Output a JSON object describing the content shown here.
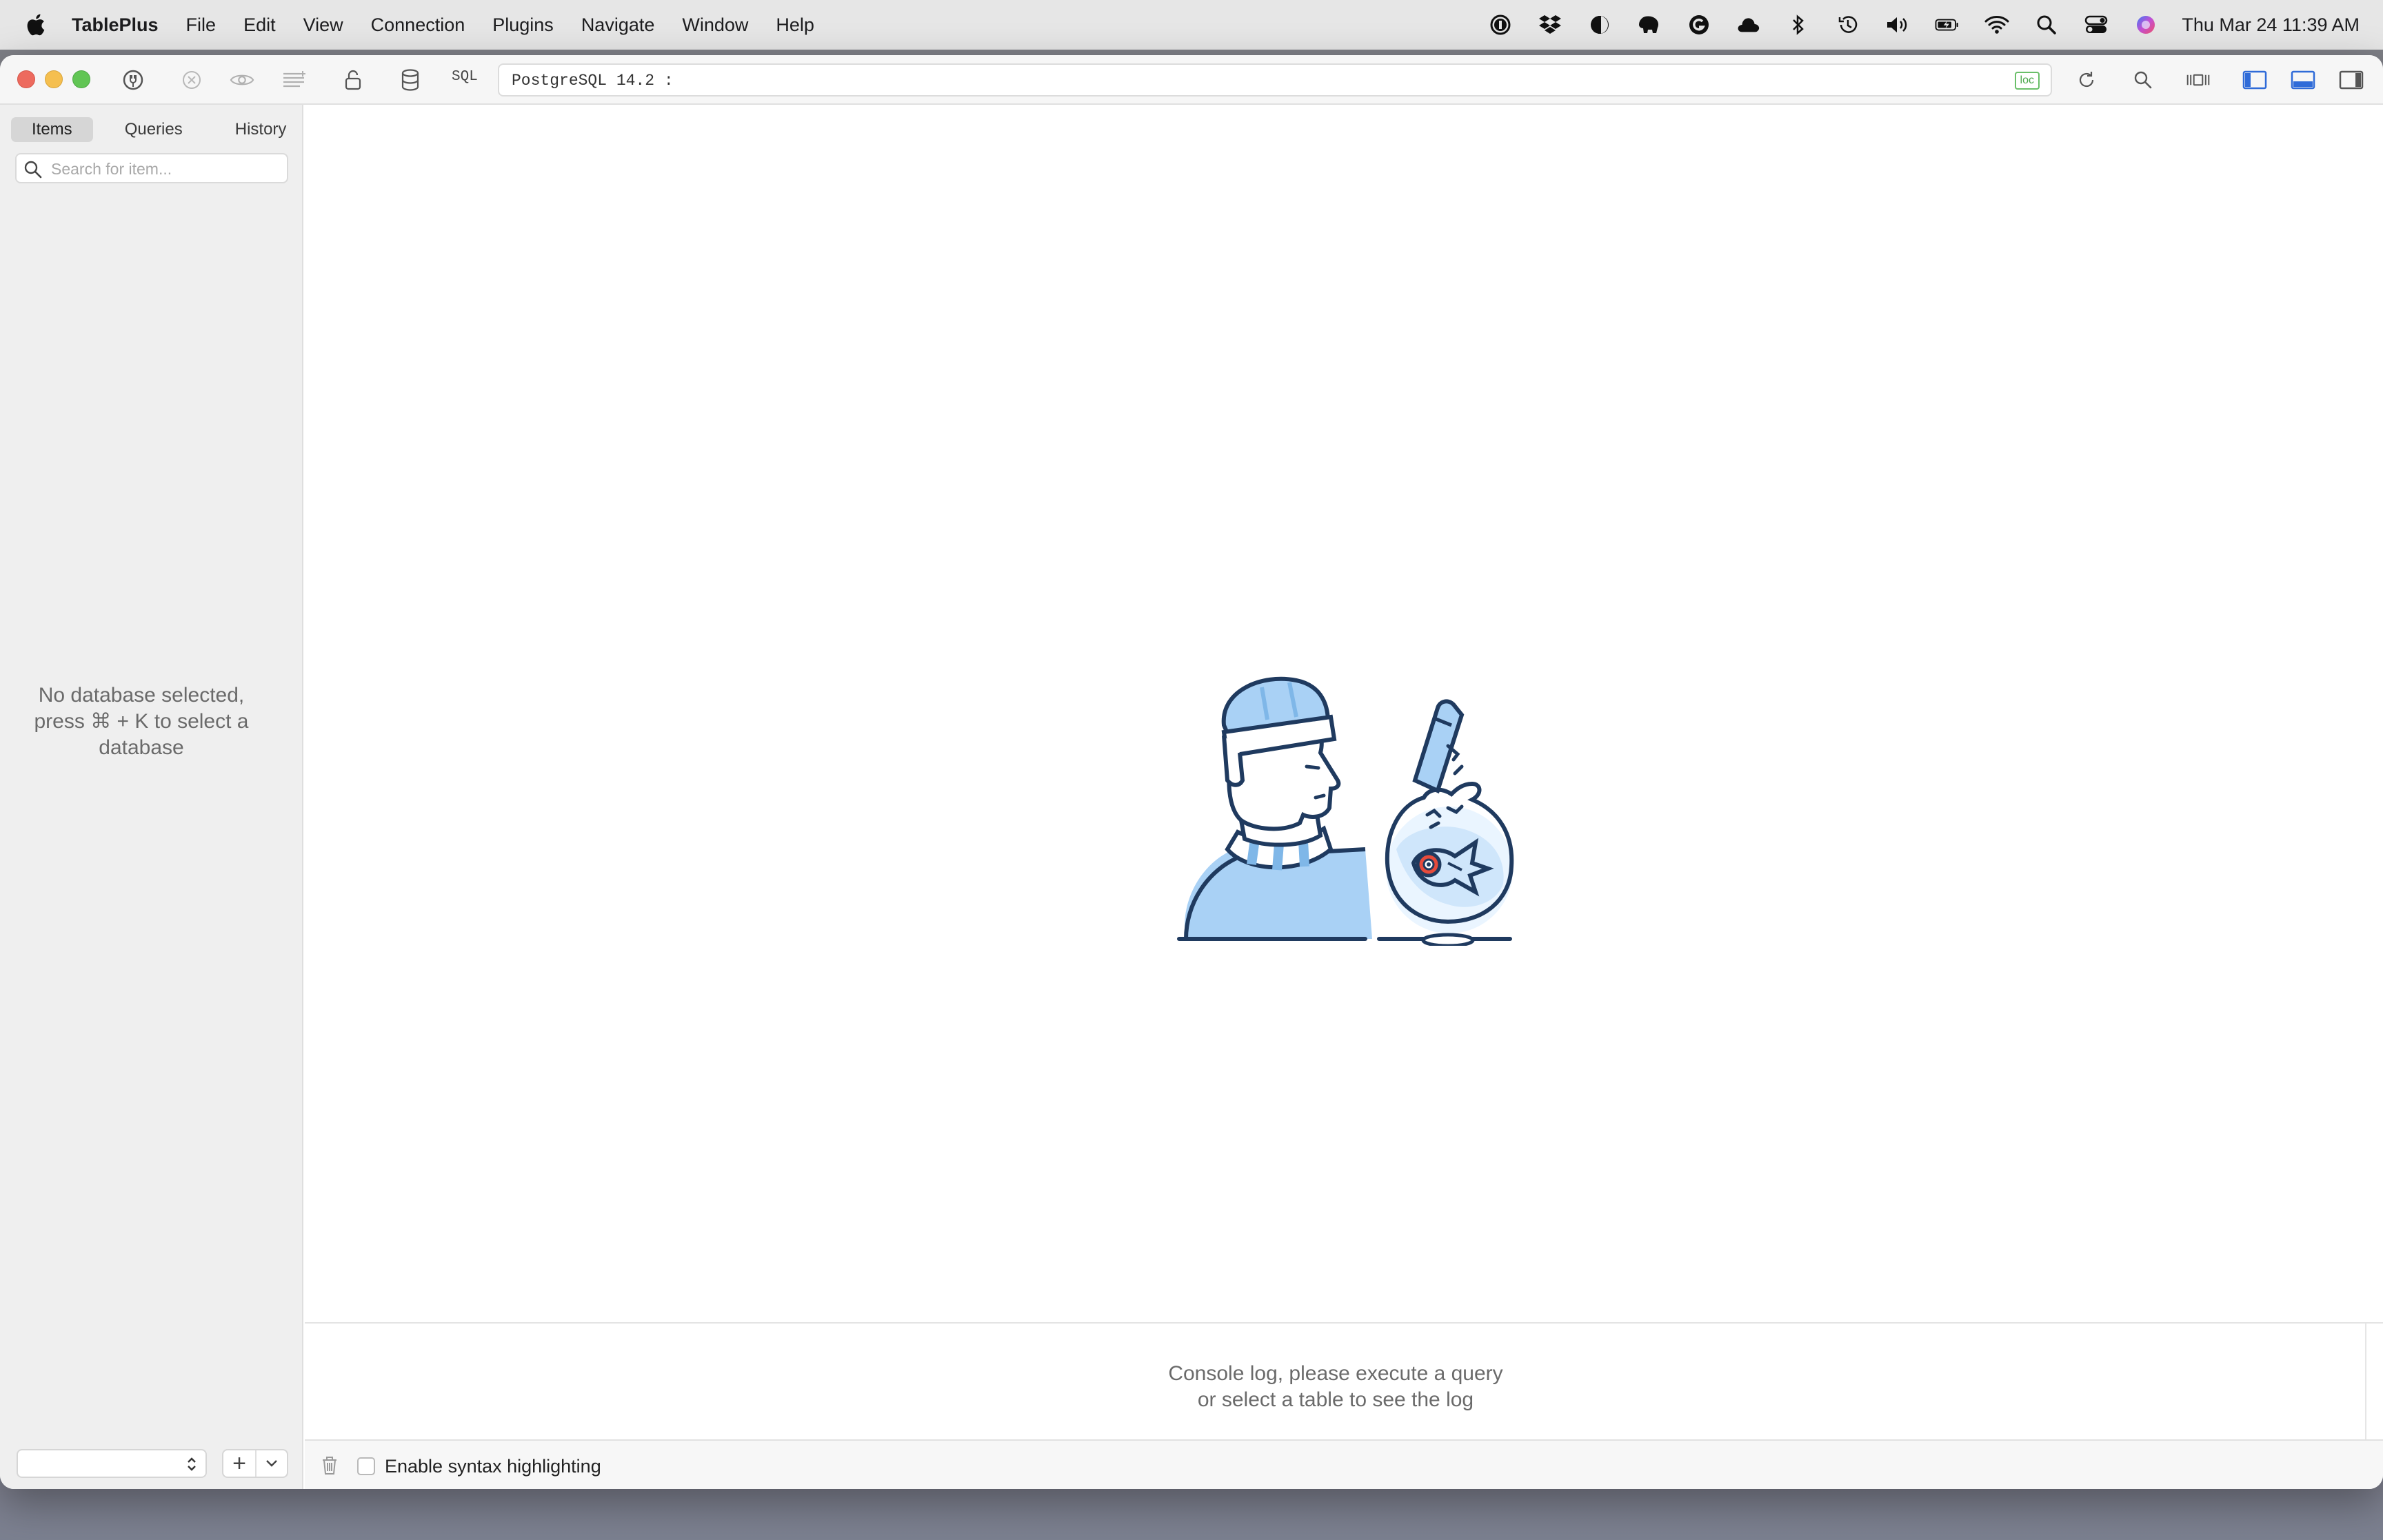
{
  "menubar": {
    "app_name": "TablePlus",
    "items": [
      "File",
      "Edit",
      "View",
      "Connection",
      "Plugins",
      "Navigate",
      "Window",
      "Help"
    ],
    "clock": "Thu Mar 24  11:39 AM",
    "status_icons": [
      "1password-icon",
      "dropbox-icon",
      "contrast-icon",
      "elephant-icon",
      "grammarly-icon",
      "cloud-icon",
      "bluetooth-icon",
      "time-machine-icon",
      "volume-icon",
      "battery-icon",
      "wifi-icon",
      "spotlight-icon",
      "control-center-icon",
      "siri-icon"
    ]
  },
  "toolbar": {
    "sql_label": "SQL",
    "connection_text": "PostgreSQL 14.2 :",
    "env_badge": "loc",
    "highlight_color": "#f5f53a"
  },
  "sidebar": {
    "tabs": [
      "Items",
      "Queries",
      "History"
    ],
    "active_tab": "Items",
    "search_placeholder": "Search for item...",
    "empty_message": "No database selected, press ⌘ + K to select a database",
    "add_label": "+"
  },
  "console": {
    "message_line1": "Console log, please execute a query",
    "message_line2": "or select a table to see the log"
  },
  "bottombar": {
    "syntax_label": "Enable syntax highlighting",
    "syntax_checked": false
  },
  "colors": {
    "accent_blue": "#2f6bd8",
    "illustration_navy": "#1f3a5f",
    "illustration_light_blue": "#a9d1f5",
    "traffic_red": "#ed6a5e",
    "traffic_yellow": "#f5bf4f",
    "traffic_green": "#61c554"
  }
}
